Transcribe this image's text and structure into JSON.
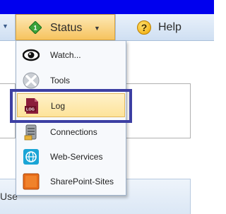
{
  "toolbar": {
    "status_label": "Status",
    "help_label": "Help"
  },
  "status_menu": {
    "items": [
      {
        "label": "Watch...",
        "icon": "eye-icon"
      },
      {
        "label": "Tools",
        "icon": "tools-icon"
      },
      {
        "label": "Log",
        "icon": "log-icon"
      },
      {
        "label": "Connections",
        "icon": "connections-icon"
      },
      {
        "label": "Web-Services",
        "icon": "web-services-icon"
      },
      {
        "label": "SharePoint-Sites",
        "icon": "sharepoint-icon"
      }
    ],
    "highlighted_item": "Log"
  },
  "background": {
    "bottom_label": "Use"
  },
  "colors": {
    "top_strip": "#0000ee",
    "menu_highlight": "#fde39a",
    "focus_outline": "#3c3fa3",
    "status_icon": "#3aa339",
    "help_icon": "#f0a600",
    "log_icon": "#8b1d3a",
    "web_icon": "#1aa5d6",
    "sharepoint_icon": "#e86d1a"
  }
}
